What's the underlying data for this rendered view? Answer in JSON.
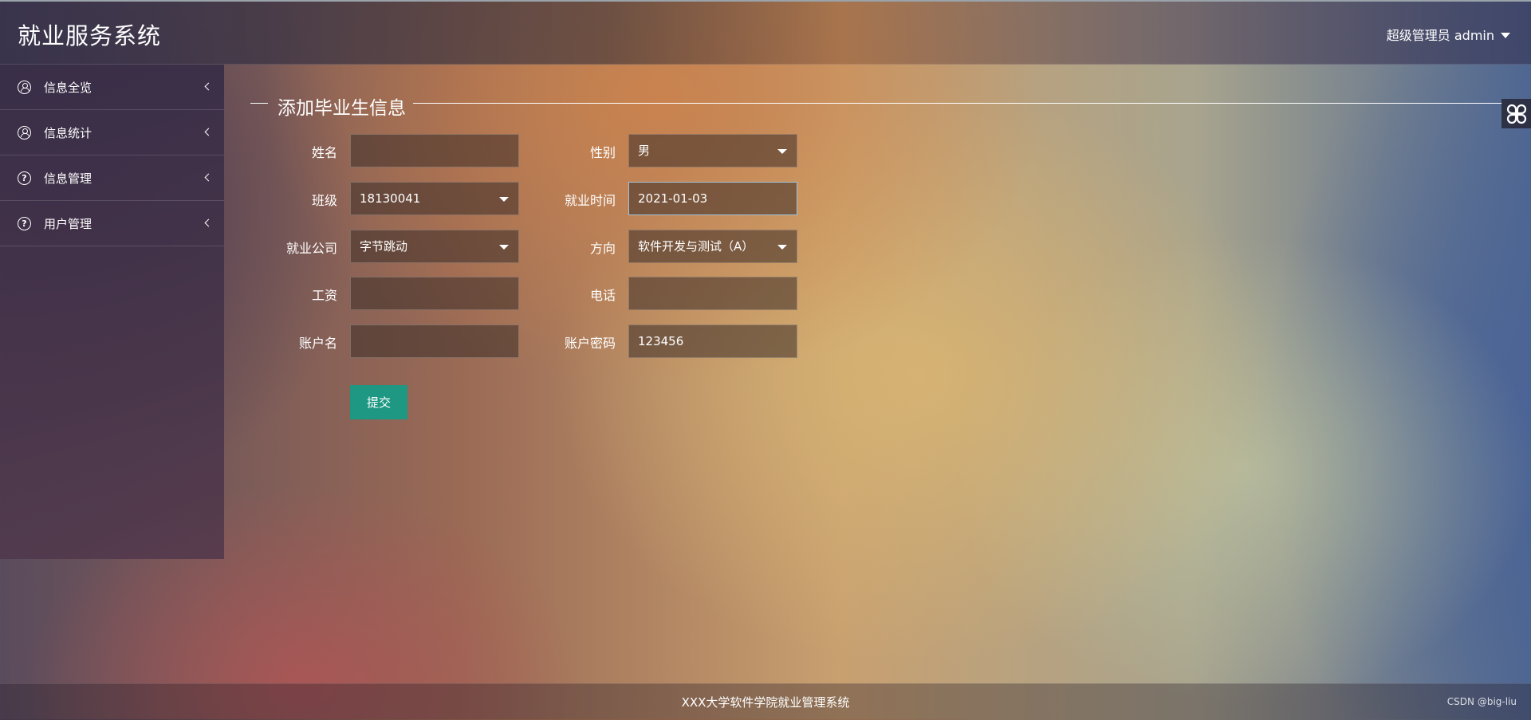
{
  "header": {
    "app_title": "就业服务系统",
    "user_label": "超级管理员 admin"
  },
  "sidebar": {
    "items": [
      {
        "label": "信息全览",
        "icon": "user-circle-icon"
      },
      {
        "label": "信息统计",
        "icon": "user-circle-icon"
      },
      {
        "label": "信息管理",
        "icon": "question-circle-icon"
      },
      {
        "label": "用户管理",
        "icon": "question-circle-icon"
      }
    ]
  },
  "form": {
    "legend": "添加毕业生信息",
    "fields": {
      "name": {
        "label": "姓名",
        "value": ""
      },
      "gender": {
        "label": "性别",
        "value": "男"
      },
      "class": {
        "label": "班级",
        "value": "18130041"
      },
      "employment_date": {
        "label": "就业时间",
        "value": "2021-01-03"
      },
      "company": {
        "label": "就业公司",
        "value": "字节跳动"
      },
      "direction": {
        "label": "方向",
        "value": "软件开发与测试（A）"
      },
      "salary": {
        "label": "工资",
        "value": ""
      },
      "phone": {
        "label": "电话",
        "value": ""
      },
      "account_name": {
        "label": "账户名",
        "value": ""
      },
      "account_password": {
        "label": "账户密码",
        "value": "123456"
      }
    },
    "submit_label": "提交"
  },
  "footer": {
    "text": "XXX大学软件学院就业管理系统",
    "watermark": "CSDN @big-liu"
  },
  "colors": {
    "submit_button": "#1e9783"
  }
}
